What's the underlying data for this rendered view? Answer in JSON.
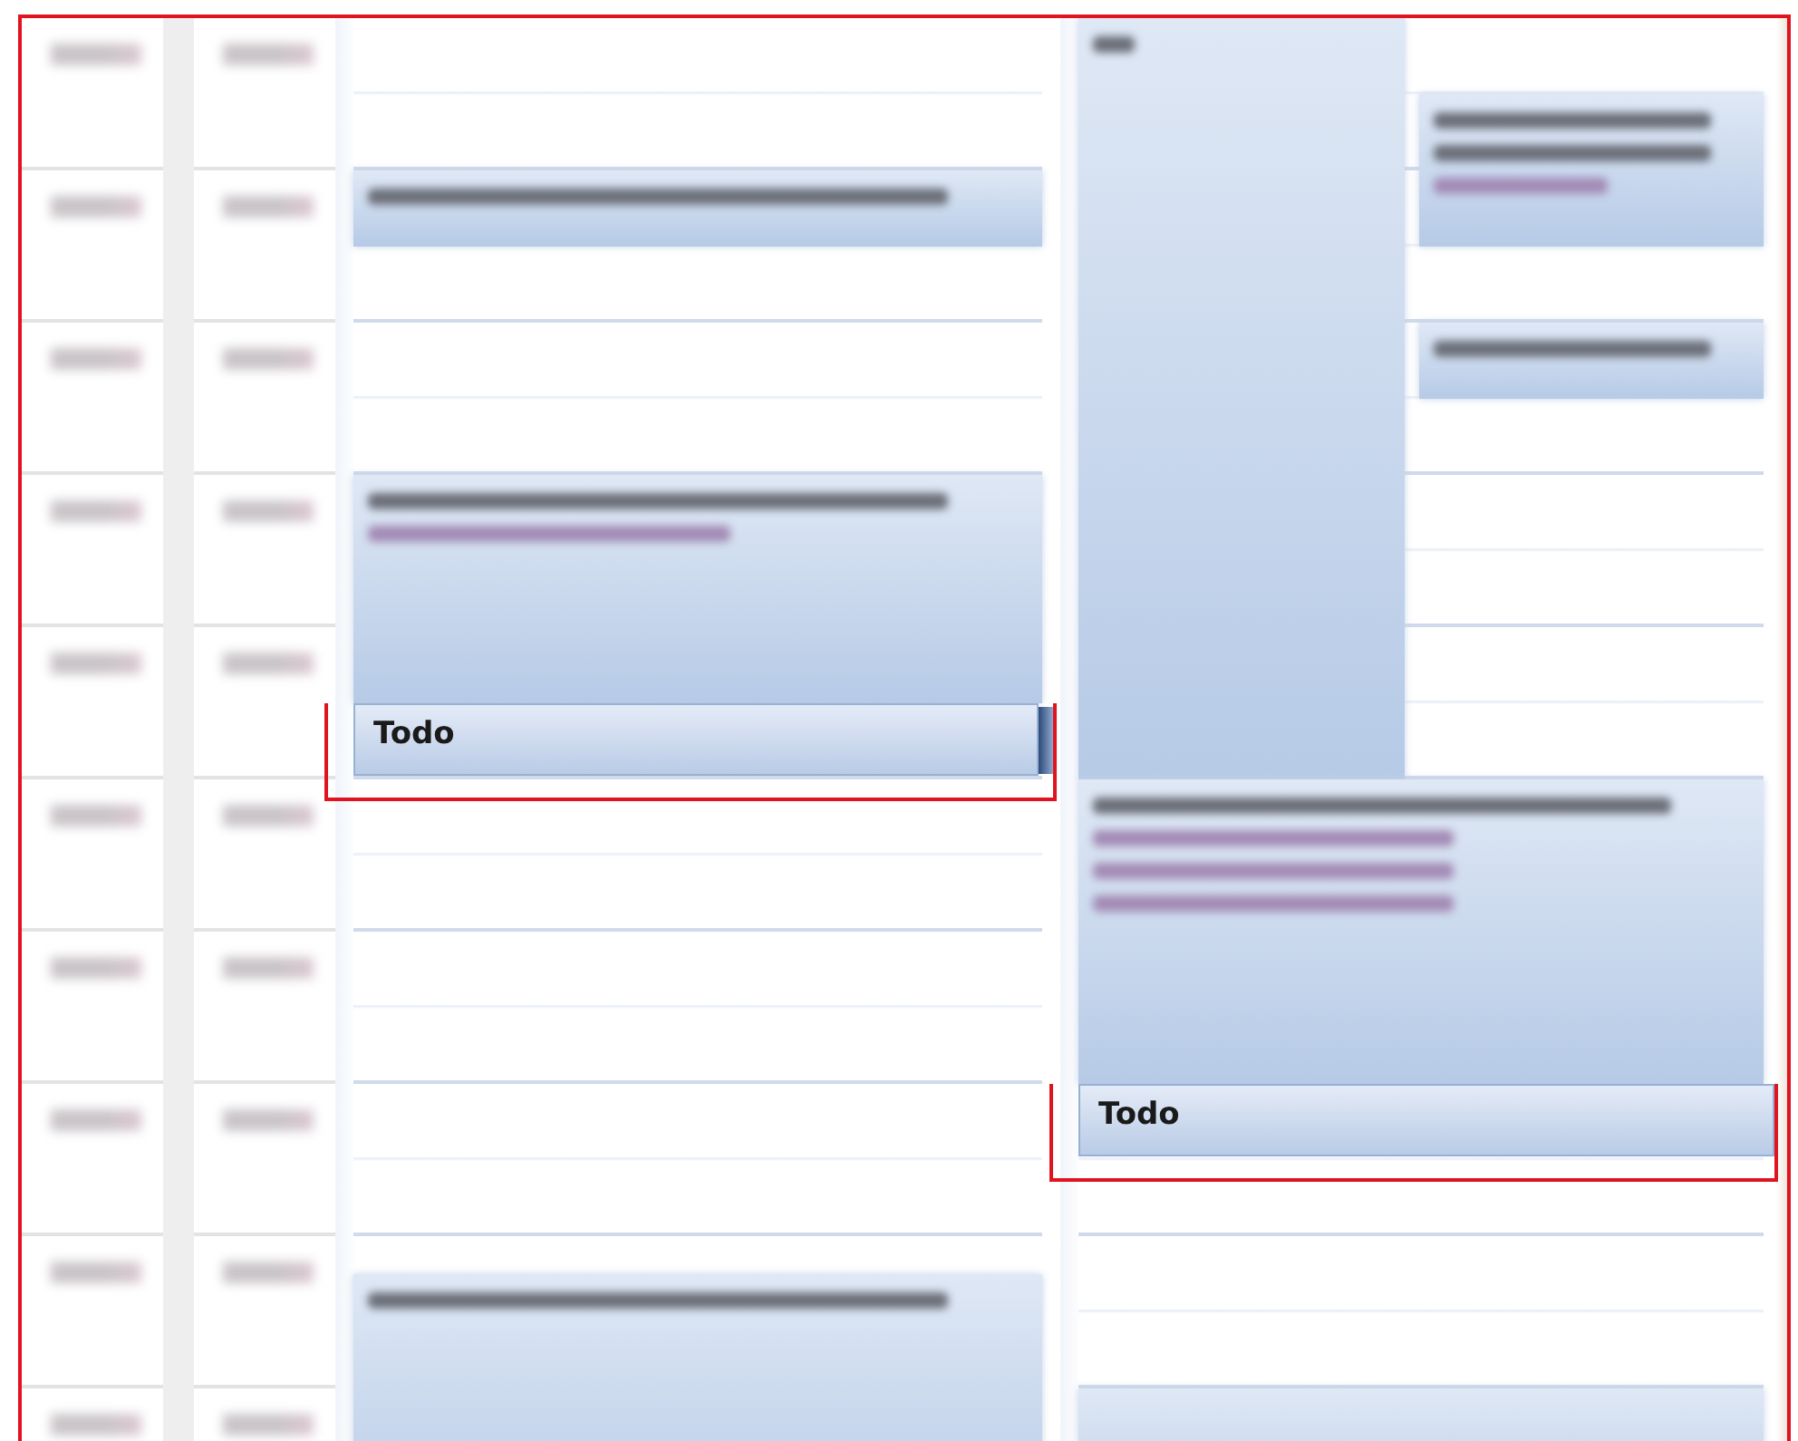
{
  "time_rows": [
    {
      "kind": "blurred"
    },
    {
      "kind": "blurred"
    },
    {
      "kind": "blurred"
    },
    {
      "kind": "blurred"
    },
    {
      "kind": "blurred"
    },
    {
      "kind": "blurred"
    },
    {
      "kind": "blurred"
    },
    {
      "kind": "blurred"
    },
    {
      "kind": "blurred"
    },
    {
      "kind": "blurred"
    }
  ],
  "days": [
    {
      "events": [
        {
          "kind": "blurred"
        },
        {
          "kind": "blurred"
        },
        {
          "kind": "todo",
          "title": "Todo",
          "highlighted": true
        },
        {
          "kind": "blurred"
        }
      ]
    },
    {
      "events": [
        {
          "kind": "blurred"
        },
        {
          "kind": "blurred"
        },
        {
          "kind": "blurred"
        },
        {
          "kind": "blurred"
        },
        {
          "kind": "todo",
          "title": "Todo",
          "highlighted": true
        },
        {
          "kind": "blurred"
        }
      ]
    }
  ]
}
